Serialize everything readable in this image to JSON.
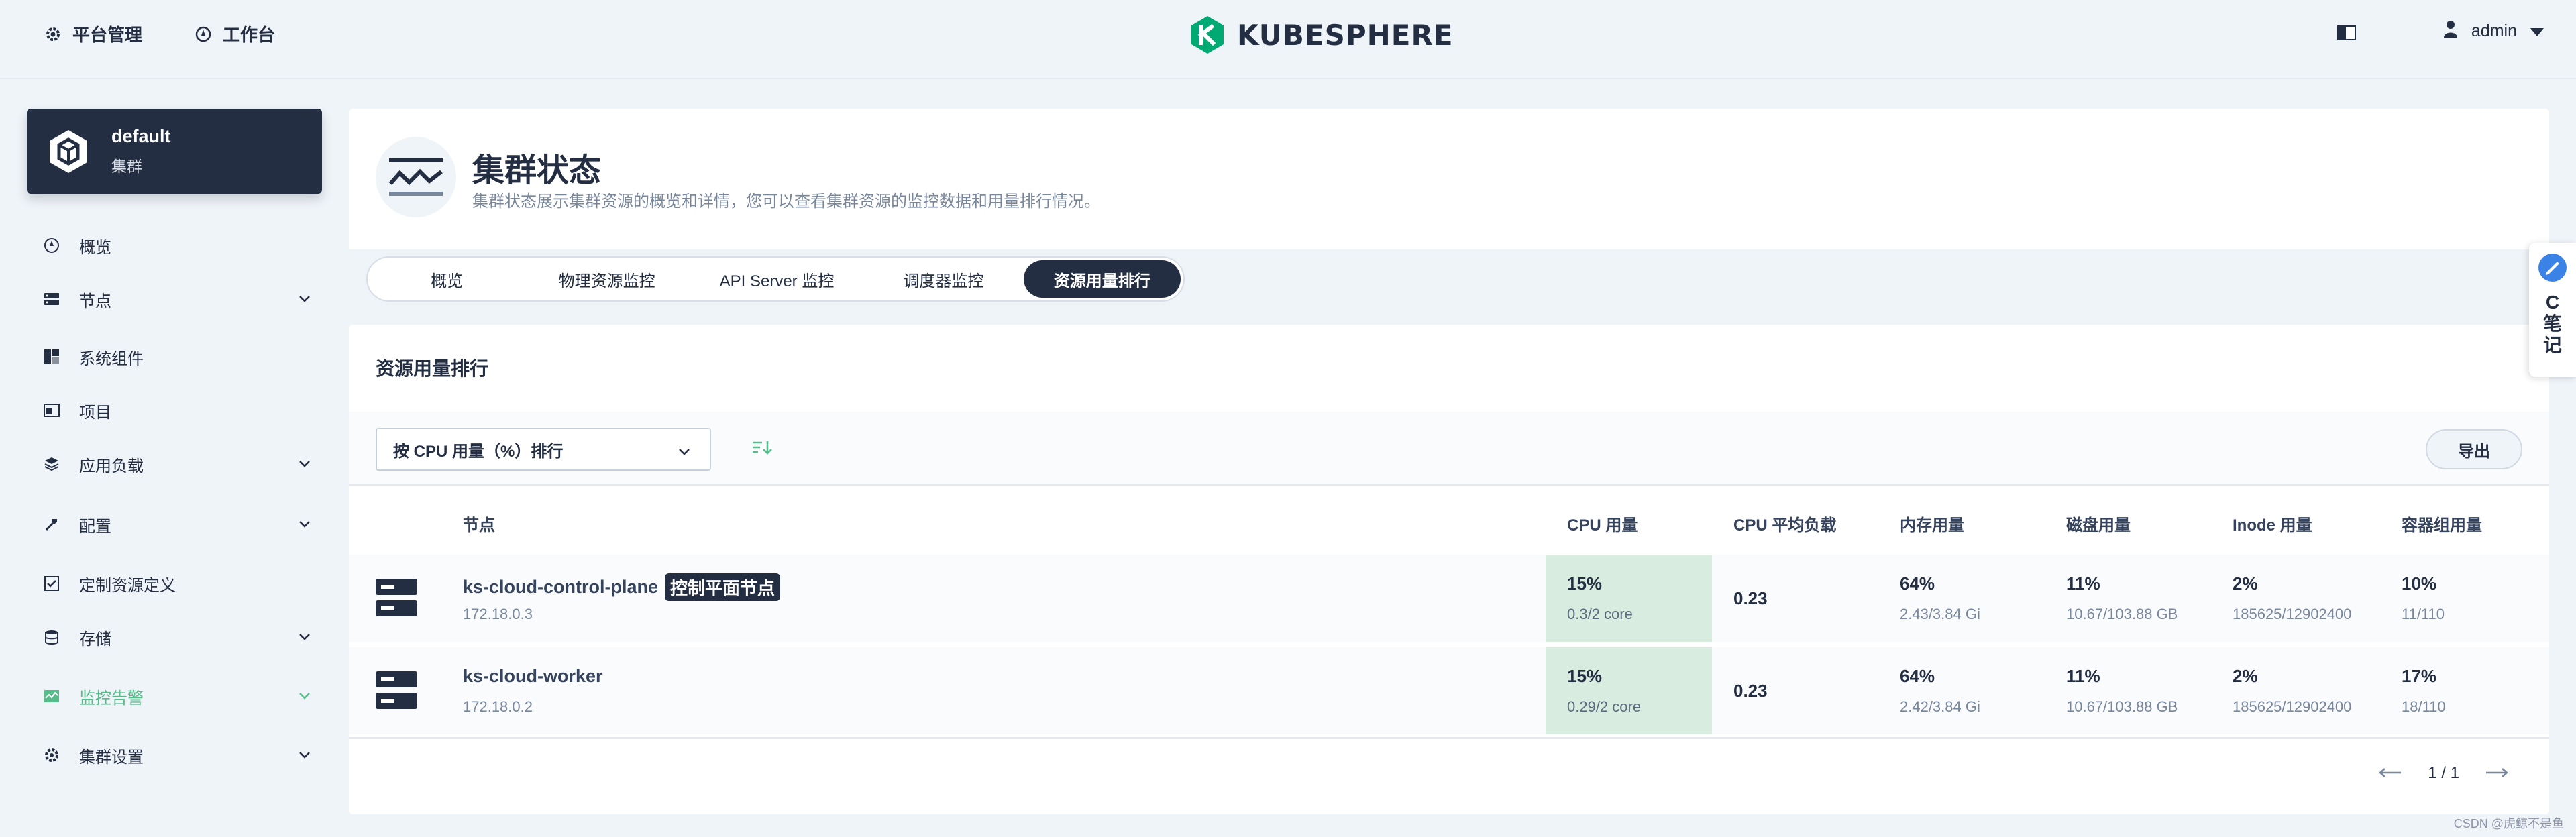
{
  "topbar": {
    "platform_label": "平台管理",
    "workbench_label": "工作台",
    "logo_text": "KUBESPHERE",
    "user_name": "admin"
  },
  "sidebar": {
    "cluster": {
      "name": "default",
      "type": "集群"
    },
    "items": [
      {
        "label": "概览",
        "icon": "dashboard-icon",
        "expandable": false,
        "active": false
      },
      {
        "label": "节点",
        "icon": "nodes-icon",
        "expandable": true,
        "active": false
      },
      {
        "label": "系统组件",
        "icon": "components-icon",
        "expandable": false,
        "active": false
      },
      {
        "label": "项目",
        "icon": "project-icon",
        "expandable": false,
        "active": false
      },
      {
        "label": "应用负载",
        "icon": "workload-icon",
        "expandable": true,
        "active": false
      },
      {
        "label": "配置",
        "icon": "config-icon",
        "expandable": true,
        "active": false
      },
      {
        "label": "定制资源定义",
        "icon": "crd-icon",
        "expandable": false,
        "active": false
      },
      {
        "label": "存储",
        "icon": "storage-icon",
        "expandable": true,
        "active": false
      },
      {
        "label": "监控告警",
        "icon": "monitoring-icon",
        "expandable": true,
        "active": true
      },
      {
        "label": "集群设置",
        "icon": "settings-icon",
        "expandable": true,
        "active": false
      }
    ]
  },
  "header": {
    "title": "集群状态",
    "description": "集群状态展示集群资源的概览和详情，您可以查看集群资源的监控数据和用量排行情况。"
  },
  "tabs": [
    {
      "label": "概览",
      "active": false
    },
    {
      "label": "物理资源监控",
      "active": false
    },
    {
      "label": "API Server 监控",
      "active": false
    },
    {
      "label": "调度器监控",
      "active": false
    },
    {
      "label": "资源用量排行",
      "active": true
    }
  ],
  "ranking": {
    "title": "资源用量排行",
    "sort_select": "按 CPU 用量（%）排行",
    "export_label": "导出",
    "columns": [
      "节点",
      "CPU 用量",
      "CPU 平均负载",
      "内存用量",
      "磁盘用量",
      "Inode 用量",
      "容器组用量"
    ],
    "rows": [
      {
        "name": "ks-cloud-control-plane",
        "badge": "控制平面节点",
        "ip": "172.18.0.3",
        "cpu": "15%",
        "cpu_sub": "0.3/2 core",
        "load": "0.23",
        "mem": "64%",
        "mem_sub": "2.43/3.84 Gi",
        "disk": "11%",
        "disk_sub": "10.67/103.88 GB",
        "inode": "2%",
        "inode_sub": "185625/12902400",
        "pods": "10%",
        "pods_sub": "11/110"
      },
      {
        "name": "ks-cloud-worker",
        "badge": "",
        "ip": "172.18.0.2",
        "cpu": "15%",
        "cpu_sub": "0.29/2 core",
        "load": "0.23",
        "mem": "64%",
        "mem_sub": "2.42/3.84 Gi",
        "disk": "11%",
        "disk_sub": "10.67/103.88 GB",
        "inode": "2%",
        "inode_sub": "185625/12902400",
        "pods": "17%",
        "pods_sub": "18/110"
      }
    ],
    "pagination": "1 / 1"
  },
  "float_widget": {
    "text": "C笔记"
  },
  "watermark": "CSDN @虎鲸不是鱼",
  "colors": {
    "primary_dark": "#242e42",
    "accent_green": "#55bc8a",
    "highlight_cell": "#d8ecdf",
    "background": "#eff4f9"
  }
}
